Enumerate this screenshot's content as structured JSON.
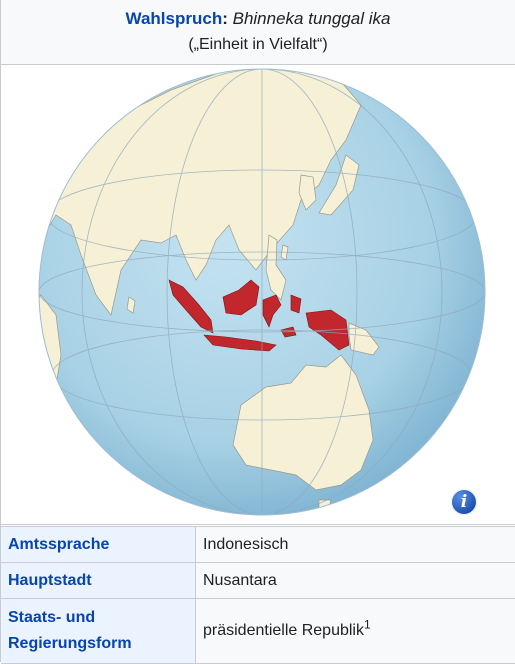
{
  "motto": {
    "label": "Wahlspruch",
    "colon": ":",
    "value": "Bhinneka tunggal ika",
    "translation": "(„Einheit in Vielfalt“)"
  },
  "map": {
    "ocean_color": "#aad3e6",
    "land_color": "#f6f0d6",
    "highlight_color": "#c1272d",
    "info_icon_glyph": "i"
  },
  "rows": [
    {
      "key": "Amtssprache",
      "value": "Indonesisch"
    },
    {
      "key": "Hauptstadt",
      "value": "Nusantara"
    },
    {
      "key": "Staats- und Regierungsform",
      "value": "präsidentielle Republik",
      "footnote": "1"
    }
  ]
}
